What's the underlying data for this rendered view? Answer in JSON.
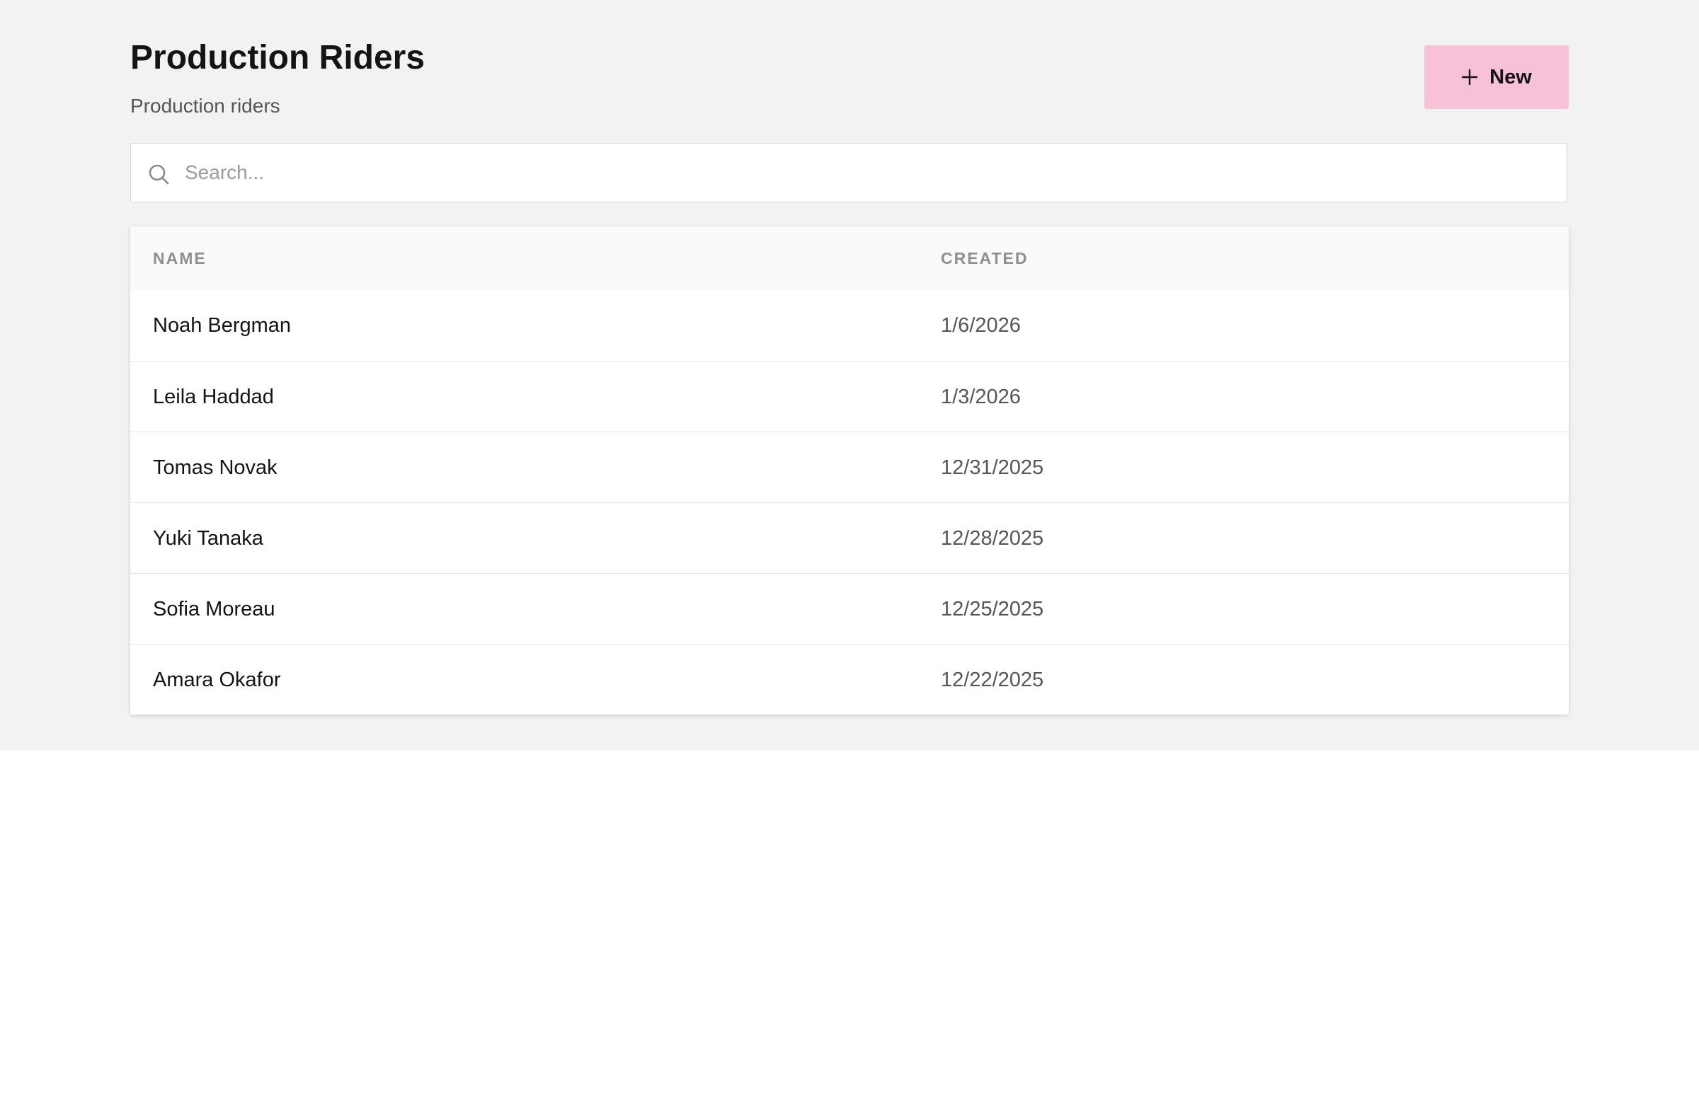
{
  "header": {
    "title": "Production Riders",
    "subtitle": "Production riders",
    "new_button_label": "New",
    "new_button_icon": "plus-icon",
    "new_button_color": "#f7c1d8"
  },
  "search": {
    "placeholder": "Search...",
    "value": "",
    "icon": "search-icon"
  },
  "table": {
    "columns": [
      "NAME",
      "CREATED"
    ],
    "rows": [
      {
        "name": "Noah Bergman",
        "created": "1/6/2026"
      },
      {
        "name": "Leila Haddad",
        "created": "1/3/2026"
      },
      {
        "name": "Tomas Novak",
        "created": "12/31/2025"
      },
      {
        "name": "Yuki Tanaka",
        "created": "12/28/2025"
      },
      {
        "name": "Sofia Moreau",
        "created": "12/25/2025"
      },
      {
        "name": "Amara Okafor",
        "created": "12/22/2025"
      }
    ]
  }
}
